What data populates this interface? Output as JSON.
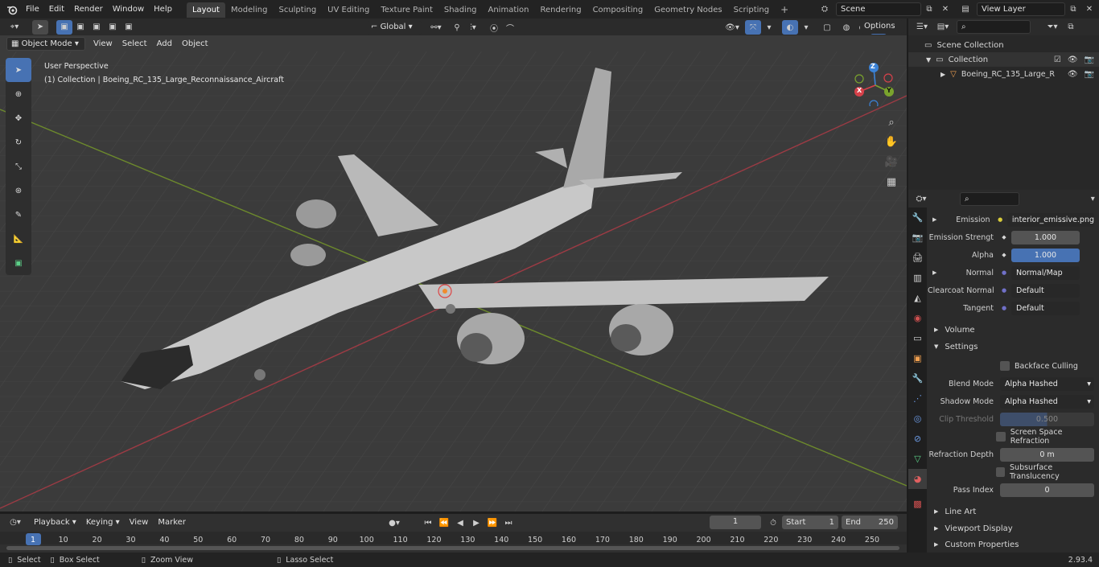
{
  "topbar": {
    "menus": [
      "File",
      "Edit",
      "Render",
      "Window",
      "Help"
    ],
    "workspaces": [
      "Layout",
      "Modeling",
      "Sculpting",
      "UV Editing",
      "Texture Paint",
      "Shading",
      "Animation",
      "Rendering",
      "Compositing",
      "Geometry Nodes",
      "Scripting"
    ],
    "active_workspace": "Layout",
    "add_tab": "+",
    "scene_name": "Scene",
    "view_layer": "View Layer"
  },
  "viewport_header": {
    "mode": "Object Mode",
    "menus": [
      "View",
      "Select",
      "Add",
      "Object"
    ],
    "orientation": "Global",
    "options": "Options"
  },
  "viewport": {
    "perspective_label": "User Perspective",
    "collection_label": "(1) Collection | Boeing_RC_135_Large_Reconnaissance_Aircraft",
    "gizmo": {
      "x": "X",
      "y": "Y",
      "z": "Z"
    }
  },
  "outliner": {
    "scene_collection": "Scene Collection",
    "collection": "Collection",
    "object": "Boeing_RC_135_Large_R"
  },
  "properties": {
    "rows": [
      {
        "label": "Emission",
        "value": "interior_emissive.png",
        "kind": "dark",
        "expand": true
      },
      {
        "label": "Emission Strengt",
        "value": "1.000",
        "kind": "num"
      },
      {
        "label": "Alpha",
        "value": "1.000",
        "kind": "blue"
      },
      {
        "label": "Normal",
        "value": "Normal/Map",
        "kind": "dark",
        "expand": true
      },
      {
        "label": "Clearcoat Normal",
        "value": "Default",
        "kind": "dark"
      },
      {
        "label": "Tangent",
        "value": "Default",
        "kind": "dark"
      }
    ],
    "volume": "Volume",
    "settings": "Settings",
    "backface_culling": "Backface Culling",
    "blend_mode_label": "Blend Mode",
    "blend_mode": "Alpha Hashed",
    "shadow_mode_label": "Shadow Mode",
    "shadow_mode": "Alpha Hashed",
    "clip_threshold_label": "Clip Threshold",
    "clip_threshold": "0.500",
    "ssr": "Screen Space Refraction",
    "refraction_depth_label": "Refraction Depth",
    "refraction_depth": "0 m",
    "subsurface": "Subsurface Translucency",
    "pass_index_label": "Pass Index",
    "pass_index": "0",
    "line_art": "Line Art",
    "viewport_display": "Viewport Display",
    "custom_properties": "Custom Properties"
  },
  "timeline": {
    "menus": [
      "Playback",
      "Keying",
      "View",
      "Marker"
    ],
    "current_frame": "1",
    "start_label": "Start",
    "start": "1",
    "end_label": "End",
    "end": "250",
    "ticks": [
      "1",
      "10",
      "20",
      "30",
      "40",
      "50",
      "60",
      "70",
      "80",
      "90",
      "100",
      "110",
      "120",
      "130",
      "140",
      "150",
      "160",
      "170",
      "180",
      "190",
      "200",
      "210",
      "220",
      "230",
      "240",
      "250"
    ]
  },
  "statusbar": {
    "select": "Select",
    "box_select": "Box Select",
    "zoom_view": "Zoom View",
    "lasso_select": "Lasso Select",
    "version": "2.93.4"
  }
}
